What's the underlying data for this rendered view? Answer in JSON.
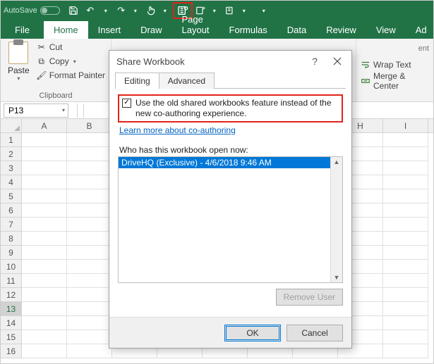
{
  "qat": {
    "autosave_label": "AutoSave",
    "autosave_state": "Off"
  },
  "tabs": {
    "file": "File",
    "home": "Home",
    "insert": "Insert",
    "draw": "Draw",
    "page_layout": "Page Layout",
    "formulas": "Formulas",
    "data": "Data",
    "review": "Review",
    "view": "View",
    "addins": "Ad"
  },
  "ribbon": {
    "paste": "Paste",
    "cut": "Cut",
    "copy": "Copy",
    "format_painter": "Format Painter",
    "clipboard": "Clipboard",
    "wrap_text": "Wrap Text",
    "merge_center": "Merge & Center",
    "ent": "ent"
  },
  "namebox": "P13",
  "columns": [
    "A",
    "B",
    "",
    "",
    "",
    "",
    "",
    "H",
    "I"
  ],
  "rows": [
    "1",
    "2",
    "3",
    "4",
    "5",
    "6",
    "7",
    "8",
    "9",
    "10",
    "11",
    "12",
    "13",
    "14",
    "15",
    "16"
  ],
  "selected_row": "13",
  "dialog": {
    "title": "Share Workbook",
    "help": "?",
    "tab_editing": "Editing",
    "tab_advanced": "Advanced",
    "checkbox_label": "Use the old shared workbooks feature instead of the new co-authoring experience.",
    "checkbox_checked": true,
    "learn_more": "Learn more about co-authoring",
    "who_label": "Who has this workbook open now:",
    "users": [
      "DriveHQ (Exclusive) - 4/6/2018 9:46 AM"
    ],
    "remove_user": "Remove User",
    "ok": "OK",
    "cancel": "Cancel"
  }
}
